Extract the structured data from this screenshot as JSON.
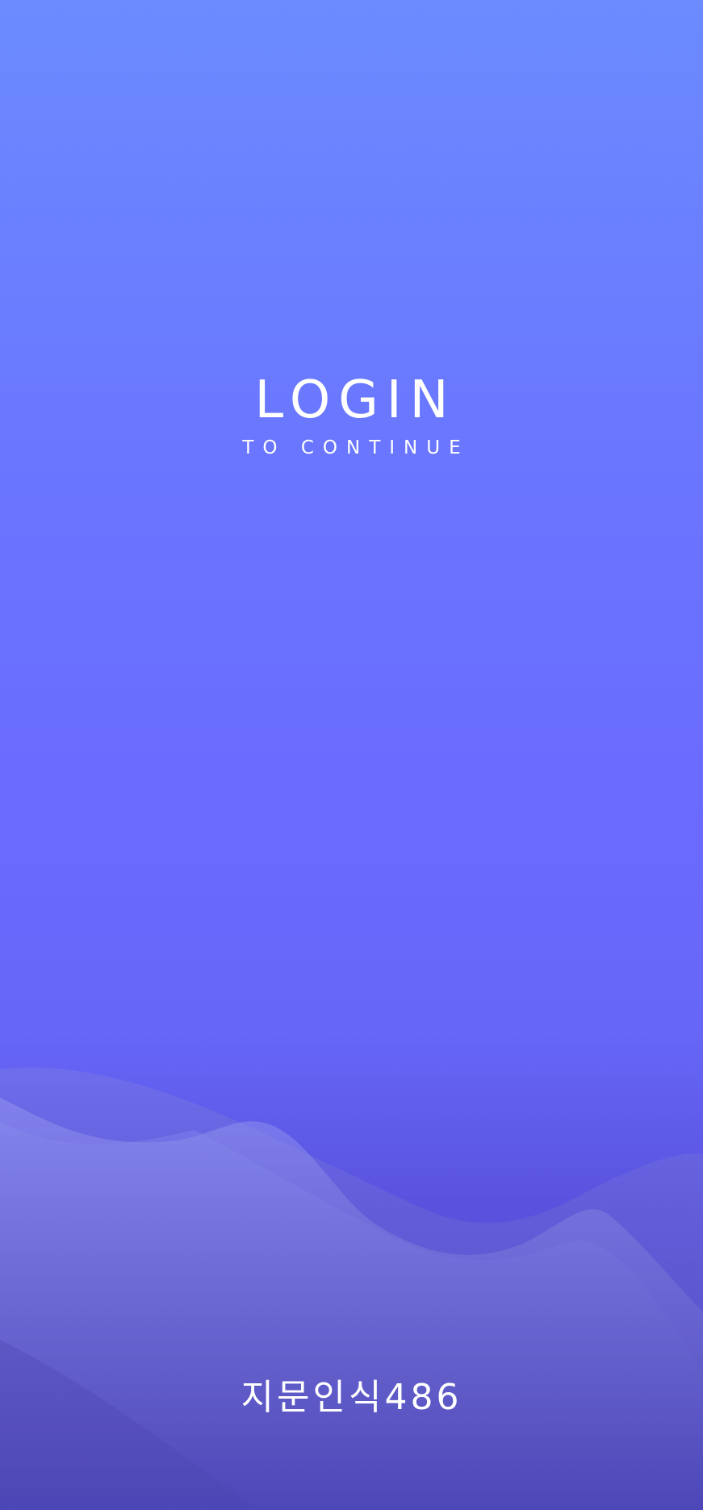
{
  "screen": {
    "title": "LOGIN",
    "subtitle": "TO CONTINUE",
    "footer_label": "지문인식486"
  },
  "colors": {
    "background_top": "#6b8bff",
    "background_mid": "#6a6aff",
    "background_bottom": "#5550d2",
    "text": "#ffffff"
  }
}
